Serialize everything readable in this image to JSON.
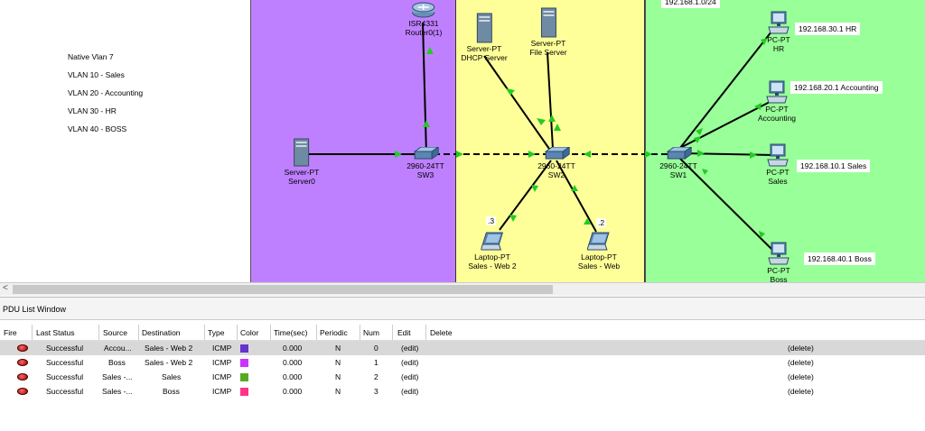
{
  "legend": [
    "Native Vlan 7",
    "VLAN 10 - Sales",
    "VLAN 20 - Accounting",
    "VLAN 30 - HR",
    "VLAN 40 - BOSS"
  ],
  "subnet_label": "192.168.1.0/24",
  "devices": {
    "router": {
      "type": "ISR4331",
      "name": "Router0(1)"
    },
    "server0": {
      "type": "Server-PT",
      "name": "Server0"
    },
    "sw3": {
      "type": "2960-24TT",
      "name": "SW3"
    },
    "dhcp": {
      "type": "Server-PT",
      "name": "DHCP Server"
    },
    "file": {
      "type": "Server-PT",
      "name": "File Server"
    },
    "sw2": {
      "type": "2960-24TT",
      "name": "SW2"
    },
    "laptop_web2": {
      "type": "Laptop-PT",
      "name": "Sales - Web 2",
      "port": ".3"
    },
    "laptop_web": {
      "type": "Laptop-PT",
      "name": "Sales - Web",
      "port": ".2"
    },
    "sw1": {
      "type": "2960-24TT",
      "name": "SW1"
    },
    "pc_hr": {
      "type": "PC-PT",
      "name": "HR",
      "ip": "192.168.30.1 HR"
    },
    "pc_acc": {
      "type": "PC-PT",
      "name": "Accounting",
      "ip": "192.168.20.1 Accounting"
    },
    "pc_sales": {
      "type": "PC-PT",
      "name": "Sales",
      "ip": "192.168.10.1 Sales"
    },
    "pc_boss": {
      "type": "PC-PT",
      "name": "Boss",
      "ip": "192.168.40.1 Boss"
    }
  },
  "scroll_left": "<",
  "pdu": {
    "title": "PDU List Window",
    "columns": [
      "Fire",
      "Last Status",
      "Source",
      "Destination",
      "Type",
      "Color",
      "Time(sec)",
      "Periodic",
      "Num",
      "Edit",
      "Delete"
    ],
    "rows": [
      {
        "status": "Successful",
        "source": "Accou...",
        "dest": "Sales - Web 2",
        "type": "ICMP",
        "color": "#6633cc",
        "time": "0.000",
        "periodic": "N",
        "num": "0",
        "edit": "(edit)",
        "delete": "(delete)"
      },
      {
        "status": "Successful",
        "source": "Boss",
        "dest": "Sales - Web 2",
        "type": "ICMP",
        "color": "#cc33ff",
        "time": "0.000",
        "periodic": "N",
        "num": "1",
        "edit": "(edit)",
        "delete": "(delete)"
      },
      {
        "status": "Successful",
        "source": "Sales -...",
        "dest": "Sales",
        "type": "ICMP",
        "color": "#55aa22",
        "time": "0.000",
        "periodic": "N",
        "num": "2",
        "edit": "(edit)",
        "delete": "(delete)"
      },
      {
        "status": "Successful",
        "source": "Sales -...",
        "dest": "Boss",
        "type": "ICMP",
        "color": "#ff3388",
        "time": "0.000",
        "periodic": "N",
        "num": "3",
        "edit": "(edit)",
        "delete": "(delete)"
      }
    ]
  }
}
